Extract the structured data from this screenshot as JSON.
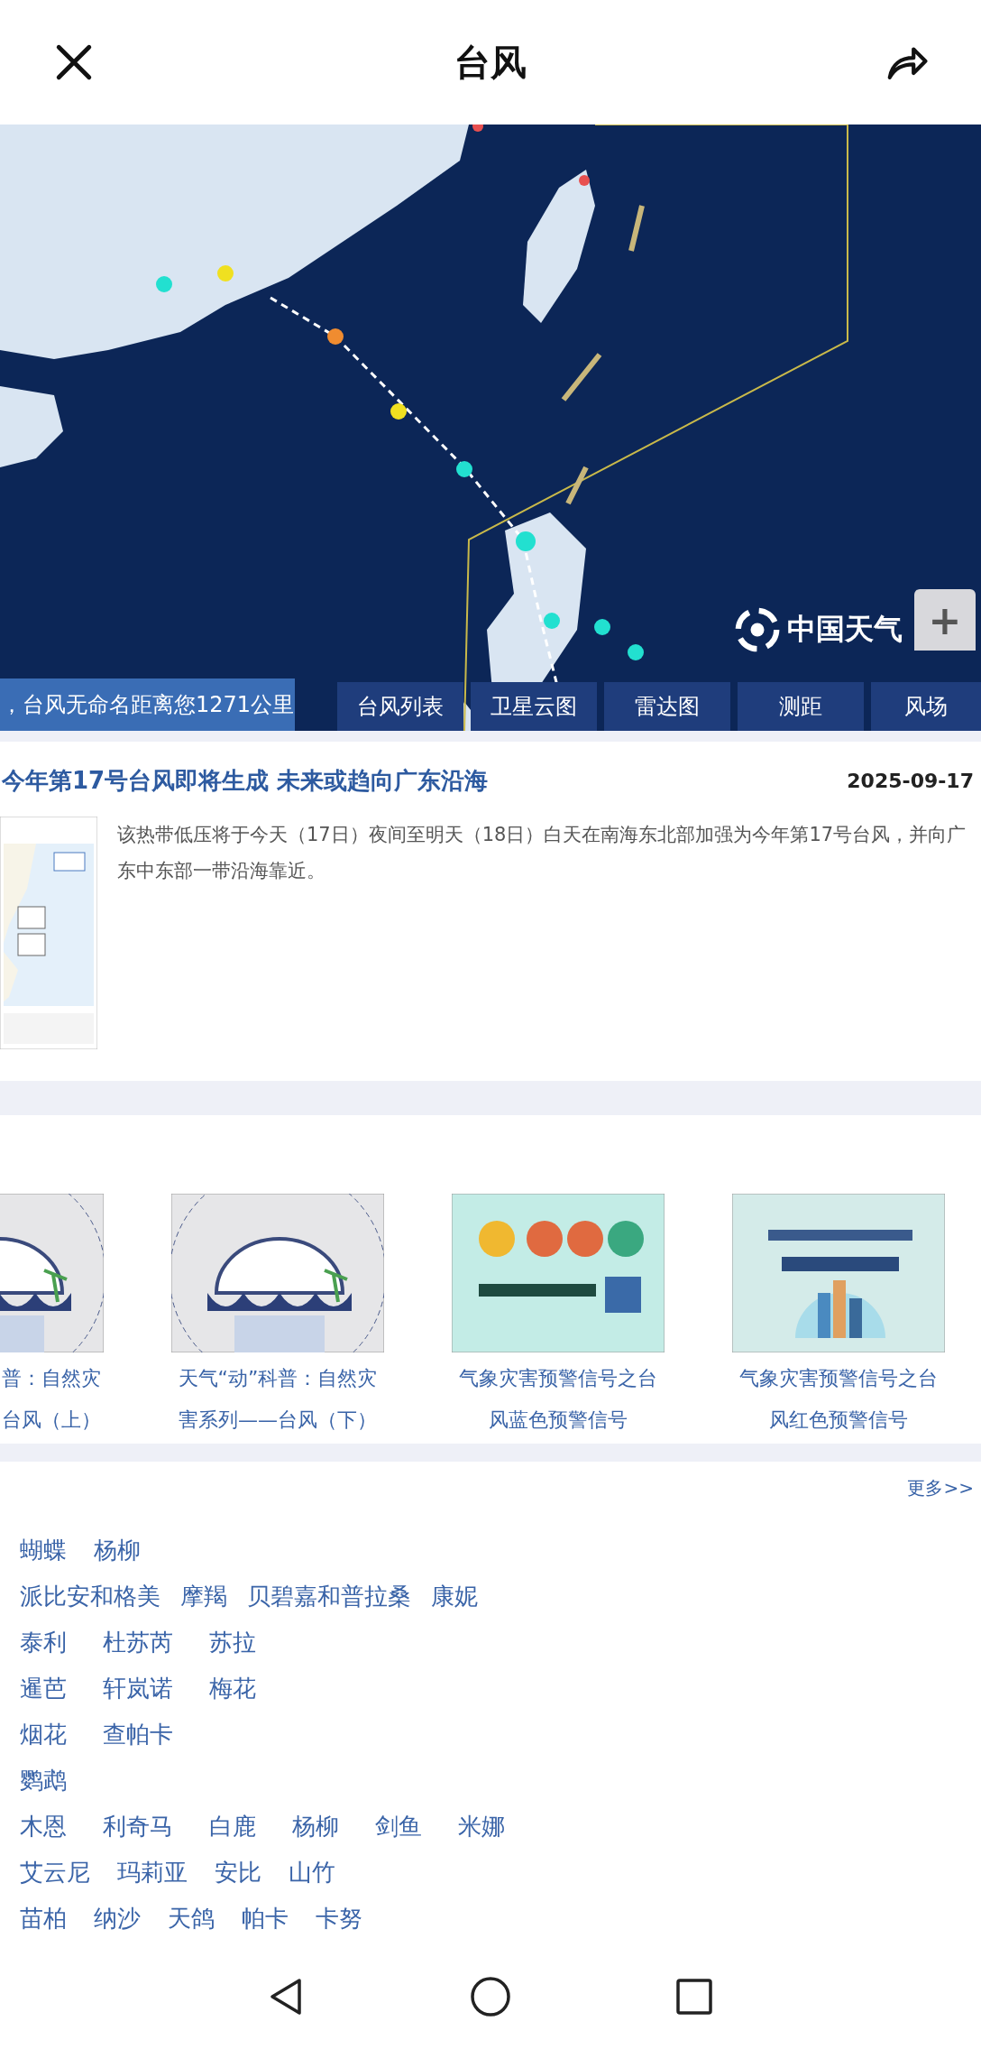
{
  "header": {
    "title": "台风"
  },
  "map": {
    "logo": "中国天气",
    "zoom_in": "+",
    "distance_notice": "，台风无命名距离您1271公里",
    "tabs": [
      {
        "label": "台风列表"
      },
      {
        "label": "卫星云图"
      },
      {
        "label": "雷达图"
      },
      {
        "label": "测距"
      },
      {
        "label": "风场"
      }
    ]
  },
  "article": {
    "title": "今年第17号台风即将生成 未来或趋向广东沿海",
    "date": "2025-09-17",
    "summary": "该热带低压将于今天（17日）夜间至明天（18日）白天在南海东北部加强为今年第17号台风，并向广东中东部一带沿海靠近。"
  },
  "videos": [
    {
      "caption_lines": [
        "普：自然灾",
        "台风（上）"
      ],
      "partial": true
    },
    {
      "caption_lines": [
        "天气“动”科普：自然灾",
        "害系列——台风（下）"
      ],
      "partial": false
    },
    {
      "caption_lines": [
        "气象灾害预警信号之台",
        "风蓝色预警信号"
      ],
      "partial": false
    },
    {
      "caption_lines": [
        "气象灾害预警信号之台",
        "风红色预警信号"
      ],
      "partial": false
    }
  ],
  "names": {
    "more": "更多>>",
    "rows": [
      [
        "蝴蝶",
        "杨柳"
      ],
      [
        "派比安和格美",
        "摩羯",
        "贝碧嘉和普拉桑",
        "康妮"
      ],
      [
        "泰利",
        "杜苏芮",
        "苏拉"
      ],
      [
        "暹芭",
        "轩岚诺",
        "梅花"
      ],
      [
        "烟花",
        "查帕卡"
      ],
      [
        "鹦鹉"
      ],
      [
        "木恩",
        "利奇马",
        "白鹿",
        "杨柳",
        "剑鱼",
        "米娜"
      ],
      [
        "艾云尼",
        "玛莉亚",
        "安比",
        "山竹"
      ],
      [
        "苗柏",
        "纳沙",
        "天鸽",
        "帕卡",
        "卡努"
      ]
    ]
  }
}
